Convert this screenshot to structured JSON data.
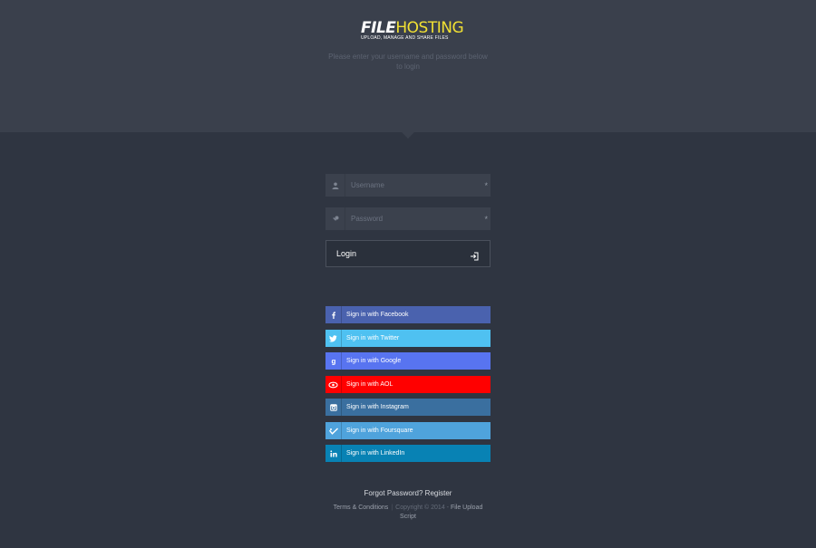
{
  "brand": {
    "name_part1": "FILE",
    "name_part2": "HOSTING",
    "tagline": "UPLOAD, MANAGE AND SHARE FILES",
    "accent_color": "#f1e033"
  },
  "intro_text": "Please enter your username and password below to login",
  "form": {
    "username": {
      "placeholder": "Username",
      "value": "",
      "icon": "user-icon",
      "required_marker": "*"
    },
    "password": {
      "placeholder": "Password",
      "value": "",
      "icon": "key-icon",
      "required_marker": "*"
    },
    "login_label": "Login",
    "login_icon": "sign-in-icon"
  },
  "social_logins": [
    {
      "label": "Sign in with Facebook",
      "icon": "facebook-icon",
      "glyph": "f",
      "color": "#4a62ae"
    },
    {
      "label": "Sign in with Twitter",
      "icon": "twitter-icon",
      "glyph": "t",
      "color": "#4fc1f1"
    },
    {
      "label": "Sign in with Google",
      "icon": "google-icon",
      "glyph": "g",
      "color": "#5874f0"
    },
    {
      "label": "Sign in with AOL",
      "icon": "aol-icon",
      "glyph": "o",
      "color": "#ff0000"
    },
    {
      "label": "Sign in with Instagram",
      "icon": "instagram-icon",
      "glyph": "i",
      "color": "#3a6f9f"
    },
    {
      "label": "Sign in with Foursquare",
      "icon": "foursquare-icon",
      "glyph": "v",
      "color": "#4fa3dc"
    },
    {
      "label": "Sign in with LinkedIn",
      "icon": "linkedin-icon",
      "glyph": "in",
      "color": "#0882b4"
    }
  ],
  "links": {
    "forgot_password": "Forgot Password?",
    "register": "Register"
  },
  "footer": {
    "terms": "Terms & Conditions",
    "separator": "|",
    "copyright": "Copyright © 2014 -",
    "script_link": "File Upload Script"
  }
}
